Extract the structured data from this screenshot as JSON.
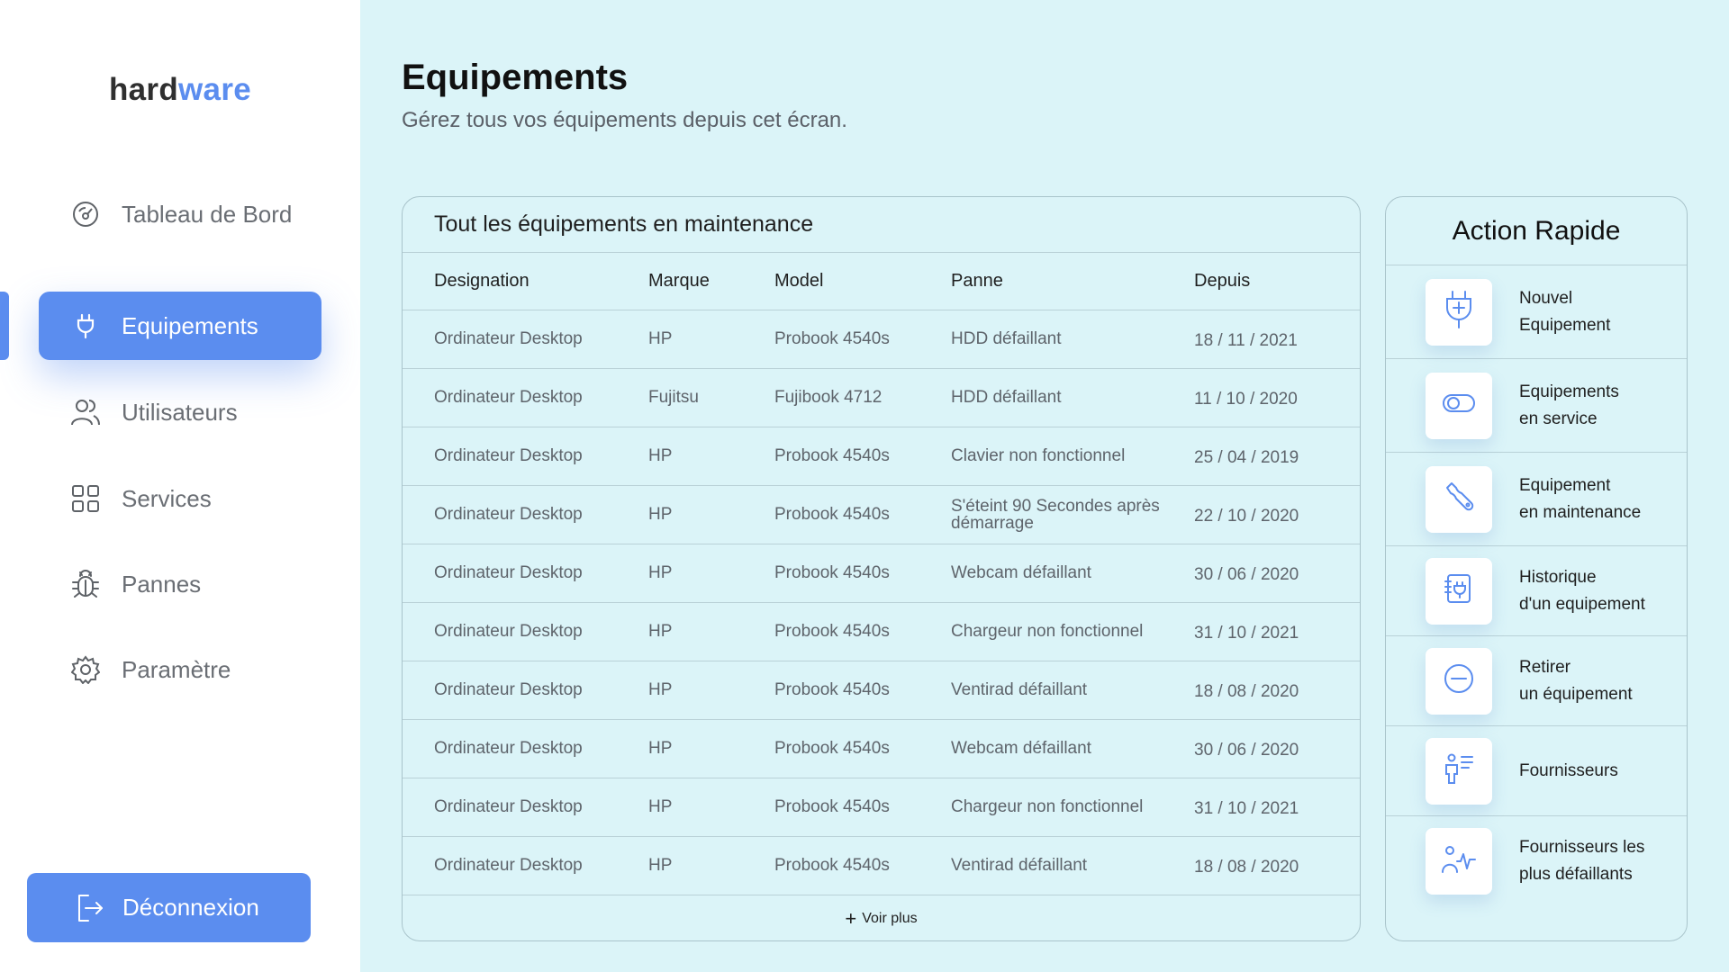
{
  "logo": {
    "part1": "hard",
    "part2": "ware"
  },
  "sidebar": {
    "items": [
      {
        "label": "Tableau de Bord",
        "icon": "dashboard-gauge-icon"
      },
      {
        "label": "Equipements",
        "icon": "plug-icon",
        "active": true
      },
      {
        "label": "Utilisateurs",
        "icon": "users-icon"
      },
      {
        "label": "Services",
        "icon": "grid-icon"
      },
      {
        "label": "Pannes",
        "icon": "bug-icon"
      },
      {
        "label": "Paramètre",
        "icon": "gear-icon"
      }
    ],
    "logout_label": "Déconnexion",
    "logout_icon": "logout-icon"
  },
  "page": {
    "title": "Equipements",
    "subtitle": "Gérez tous vos équipements depuis cet écran."
  },
  "table": {
    "title": "Tout les équipements en maintenance",
    "columns": [
      "Designation",
      "Marque",
      "Model",
      "Panne",
      "Depuis"
    ],
    "rows": [
      [
        "Ordinateur Desktop",
        "HP",
        "Probook 4540s",
        "HDD défaillant",
        "18 / 11 / 2021"
      ],
      [
        "Ordinateur Desktop",
        "Fujitsu",
        "Fujibook 4712",
        "HDD défaillant",
        "11 / 10 / 2020"
      ],
      [
        "Ordinateur Desktop",
        "HP",
        "Probook 4540s",
        "Clavier non fonctionnel",
        "25 / 04 / 2019"
      ],
      [
        "Ordinateur Desktop",
        "HP",
        "Probook 4540s",
        "S'éteint 90 Secondes après démarrage",
        "22 / 10 / 2020"
      ],
      [
        "Ordinateur Desktop",
        "HP",
        "Probook 4540s",
        "Webcam défaillant",
        "30 / 06 / 2020"
      ],
      [
        "Ordinateur Desktop",
        "HP",
        "Probook 4540s",
        "Chargeur non fonctionnel",
        "31 / 10 / 2021"
      ],
      [
        "Ordinateur Desktop",
        "HP",
        "Probook 4540s",
        "Ventirad défaillant",
        "18 / 08 / 2020"
      ],
      [
        "Ordinateur Desktop",
        "HP",
        "Probook 4540s",
        "Webcam défaillant",
        "30 / 06 / 2020"
      ],
      [
        "Ordinateur Desktop",
        "HP",
        "Probook 4540s",
        "Chargeur non fonctionnel",
        "31 / 10 / 2021"
      ],
      [
        "Ordinateur Desktop",
        "HP",
        "Probook 4540s",
        "Ventirad défaillant",
        "18 / 08 / 2020"
      ]
    ],
    "see_more_label": "Voir plus"
  },
  "quick_actions": {
    "title": "Action Rapide",
    "items": [
      {
        "line1": "Nouvel",
        "line2": "Equipement",
        "icon": "plug-add-icon"
      },
      {
        "line1": "Equipements",
        "line2": "en service",
        "icon": "toggle-icon"
      },
      {
        "line1": "Equipement",
        "line2": "en maintenance",
        "icon": "wrench-icon"
      },
      {
        "line1": "Historique",
        "line2": "d'un equipement",
        "icon": "history-document-icon"
      },
      {
        "line1": "Retirer",
        "line2": "un équipement",
        "icon": "minus-circle-icon"
      },
      {
        "line1": "Fournisseurs",
        "line2": "",
        "icon": "supplier-list-icon"
      },
      {
        "line1": "Fournisseurs les",
        "line2": "plus défaillants",
        "icon": "supplier-activity-icon"
      }
    ]
  },
  "colors": {
    "accent": "#5b8def",
    "main_background": "#dbf4f8",
    "sidebar_background": "#ffffff"
  }
}
